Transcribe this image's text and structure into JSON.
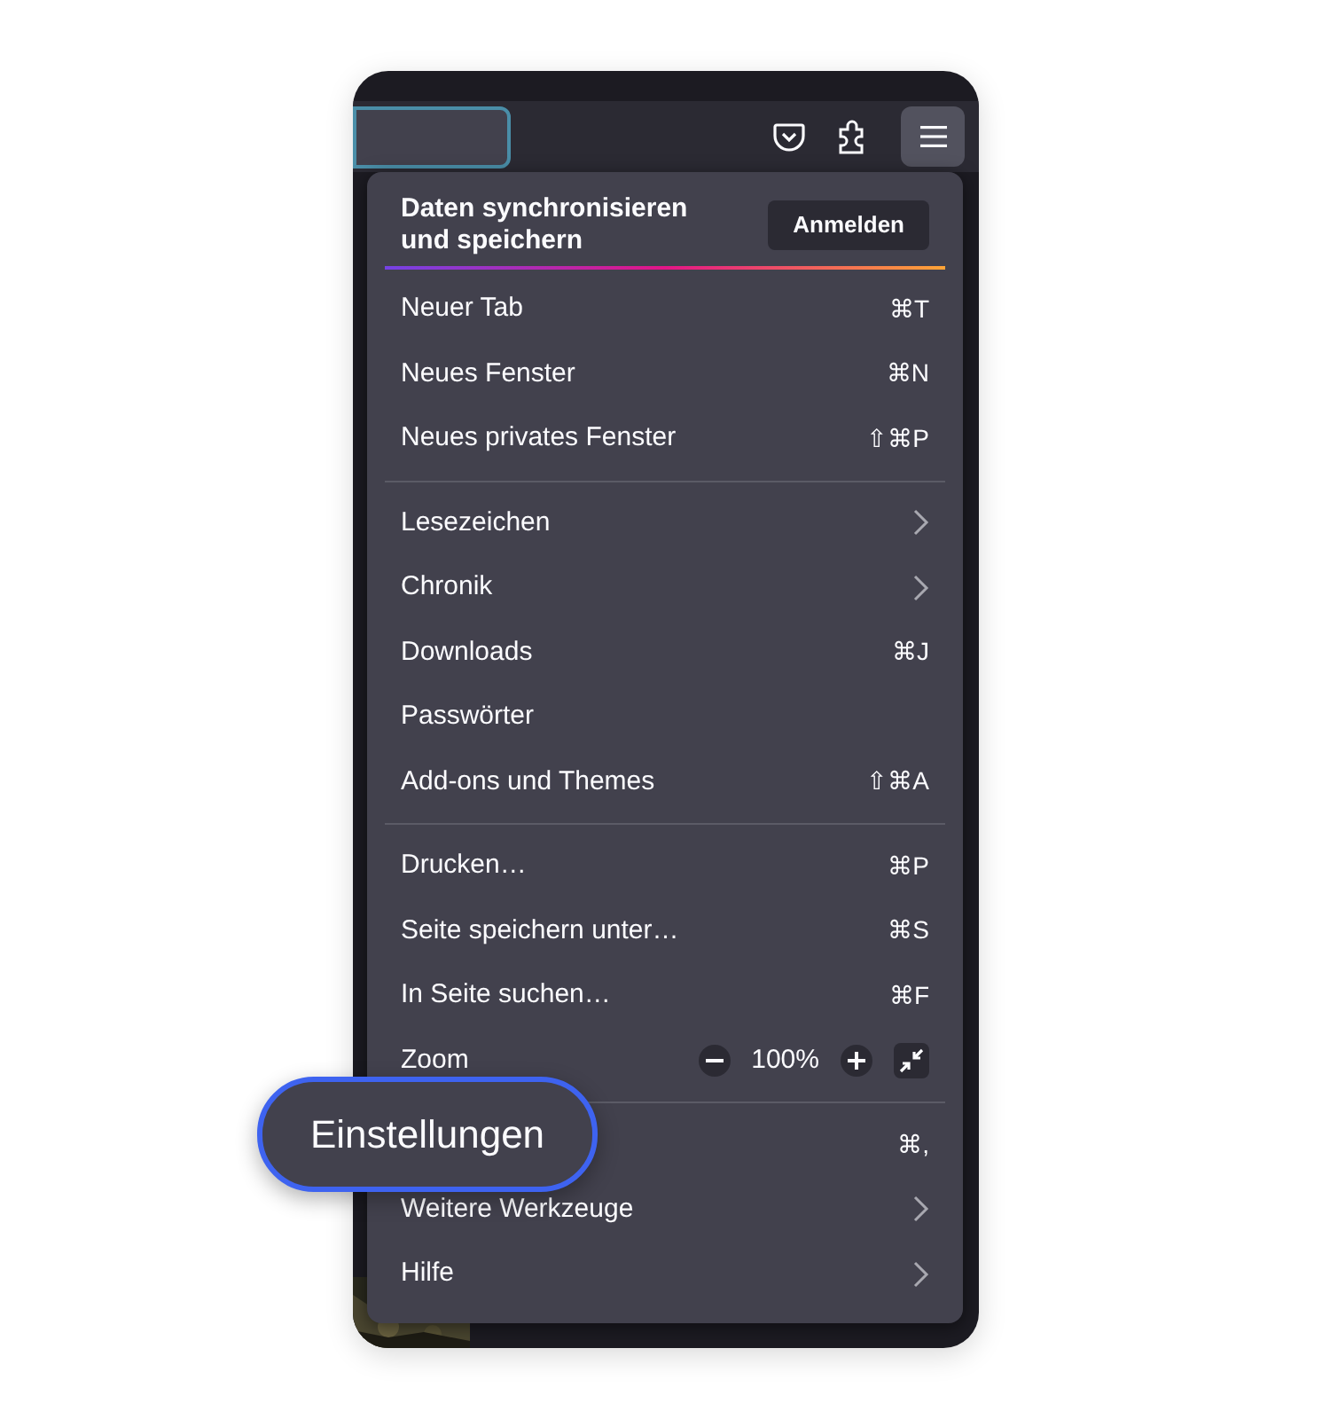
{
  "toolbar": {
    "menu_button_selected": true
  },
  "menu": {
    "header": {
      "title": "Daten synchronisieren und speichern",
      "button": "Anmelden"
    },
    "sections": [
      [
        {
          "kind": "item",
          "label": "Neuer Tab",
          "shortcut": "⌘T"
        },
        {
          "kind": "item",
          "label": "Neues Fenster",
          "shortcut": "⌘N"
        },
        {
          "kind": "item",
          "label": "Neues privates Fenster",
          "shortcut": "⇧⌘P"
        }
      ],
      [
        {
          "kind": "submenu",
          "label": "Lesezeichen"
        },
        {
          "kind": "submenu",
          "label": "Chronik"
        },
        {
          "kind": "item",
          "label": "Downloads",
          "shortcut": "⌘J"
        },
        {
          "kind": "item",
          "label": "Passwörter"
        },
        {
          "kind": "item",
          "label": "Add-ons und Themes",
          "shortcut": "⇧⌘A"
        }
      ],
      [
        {
          "kind": "item",
          "label": "Drucken…",
          "shortcut": "⌘P"
        },
        {
          "kind": "item",
          "label": "Seite speichern unter…",
          "shortcut": "⌘S"
        },
        {
          "kind": "item",
          "label": "In Seite suchen…",
          "shortcut": "⌘F"
        },
        {
          "kind": "zoom",
          "label": "Zoom",
          "value": "100%"
        }
      ],
      [
        {
          "kind": "item",
          "shortcut": "⌘,"
        },
        {
          "kind": "submenu",
          "label": "Weitere Werkzeuge"
        },
        {
          "kind": "submenu",
          "label": "Hilfe"
        }
      ]
    ]
  },
  "callout": {
    "label": "Einstellungen"
  }
}
